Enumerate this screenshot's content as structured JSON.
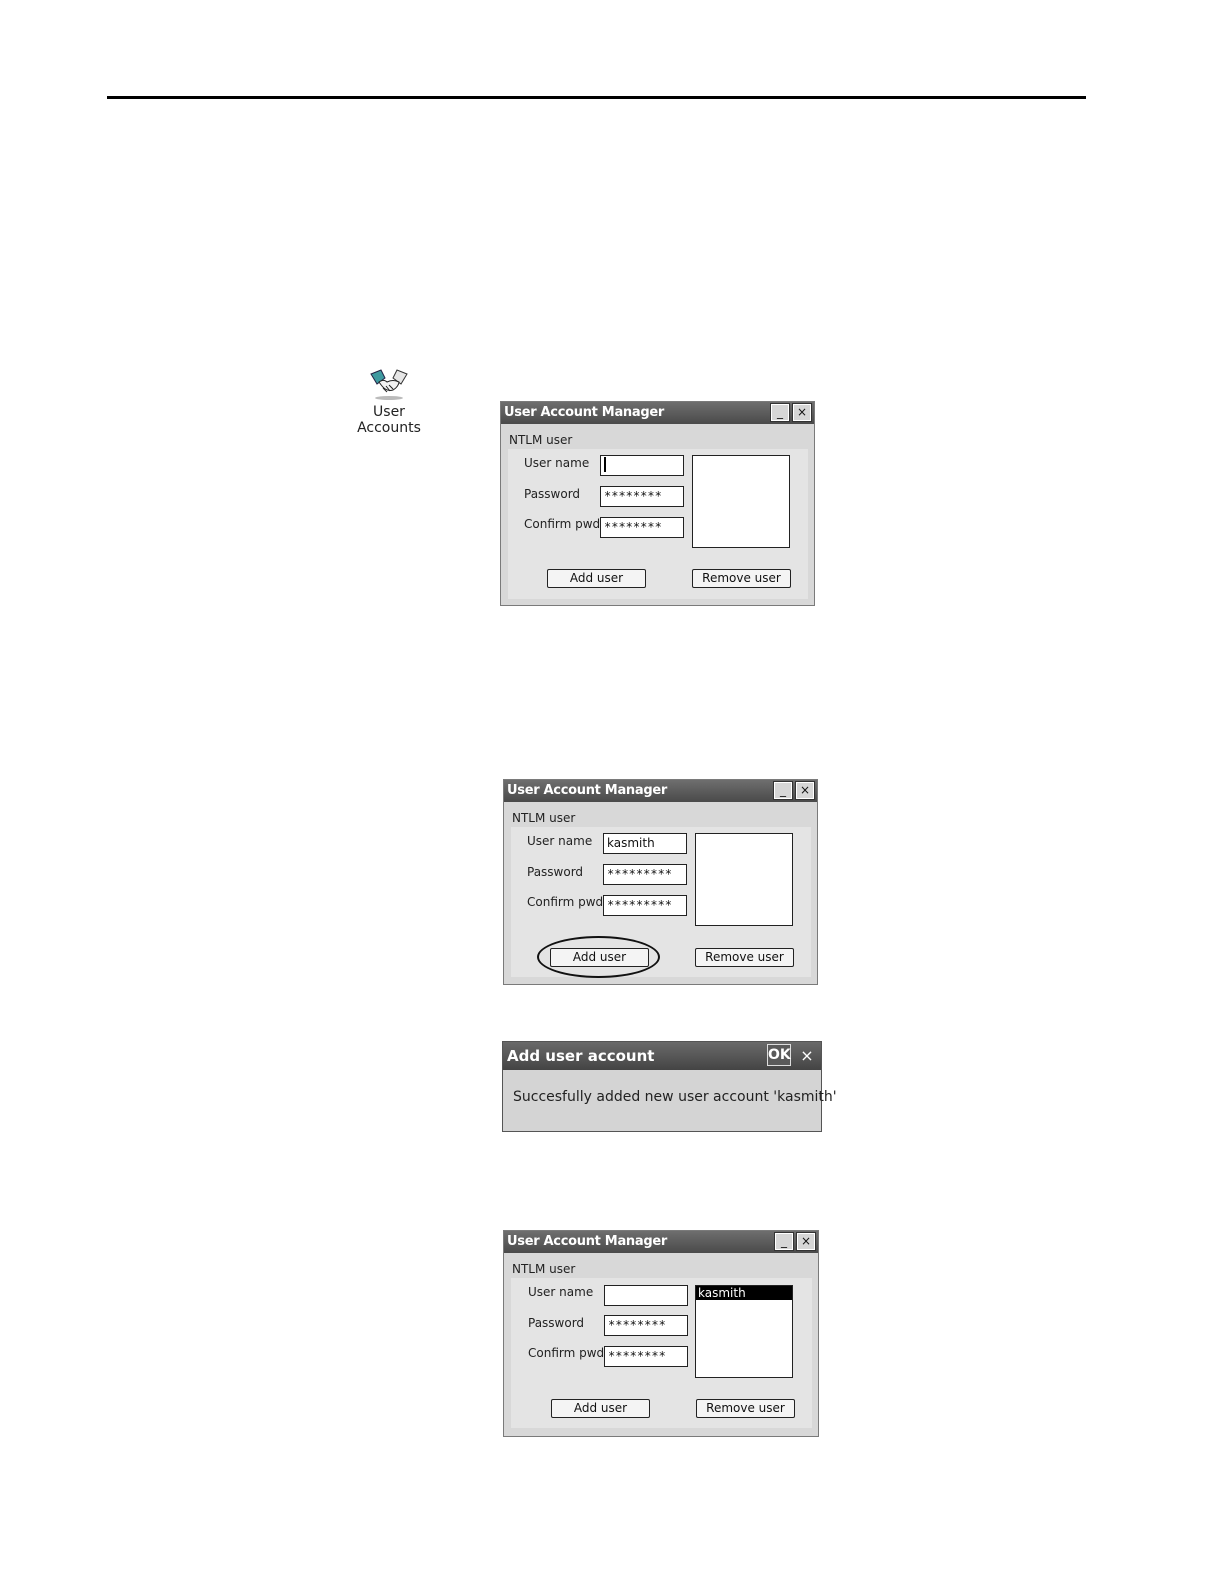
{
  "desktop_icon": {
    "label_line1": "User",
    "label_line2": "Accounts",
    "icon": "handshake-icon"
  },
  "windows": [
    {
      "title": "User Account Manager",
      "group_label": "NTLM user",
      "labels": {
        "user_name": "User name",
        "password": "Password",
        "confirm": "Confirm pwd"
      },
      "values": {
        "user_name": "",
        "password": "********",
        "confirm": "********"
      },
      "list_items": [],
      "buttons": {
        "add": "Add user",
        "remove": "Remove user"
      }
    },
    {
      "title": "User Account Manager",
      "group_label": "NTLM user",
      "labels": {
        "user_name": "User name",
        "password": "Password",
        "confirm": "Confirm pwd"
      },
      "values": {
        "user_name": "kasmith",
        "password": "*********",
        "confirm": "*********"
      },
      "list_items": [],
      "buttons": {
        "add": "Add user",
        "remove": "Remove user"
      }
    },
    {
      "title": "User Account Manager",
      "group_label": "NTLM user",
      "labels": {
        "user_name": "User name",
        "password": "Password",
        "confirm": "Confirm pwd"
      },
      "values": {
        "user_name": "",
        "password": "********",
        "confirm": "********"
      },
      "list_items": [
        "kasmith"
      ],
      "buttons": {
        "add": "Add user",
        "remove": "Remove user"
      }
    }
  ],
  "message_box": {
    "title": "Add user account",
    "ok_label": "OK",
    "close_label": "×",
    "text": "Succesfully added new user account 'kasmith'"
  },
  "titlebar_buttons": {
    "minimize": "_",
    "close": "×"
  }
}
